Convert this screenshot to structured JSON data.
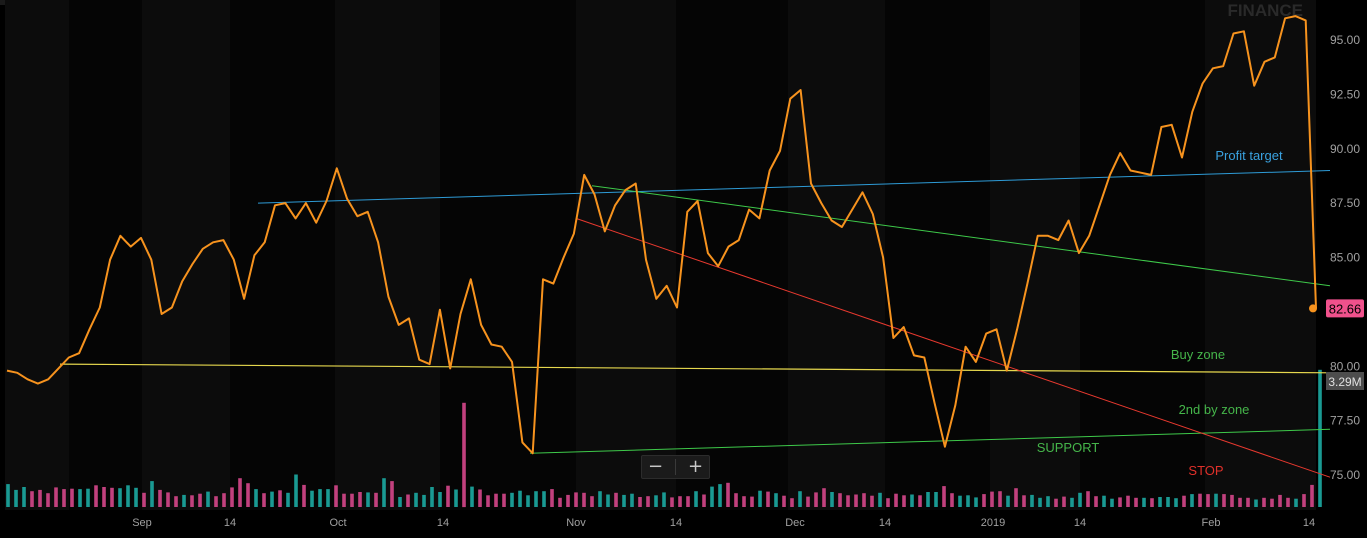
{
  "watermark": "FINANCE",
  "zoom_controls": {
    "minus": "−",
    "plus": "+"
  },
  "colors": {
    "price": "#f7931e",
    "volume_up": "#1a9a93",
    "volume_down": "#c2417e",
    "profit_target": "#2e9bd6",
    "buy_zone": "#e6d84e",
    "green_trend": "#3ec94a",
    "stop": "#e8392f",
    "label_green": "#45b54a",
    "label_blue": "#3aa2e0",
    "label_red": "#e0302a",
    "last_price_badge": "#f0518c",
    "volume_badge": "#4d4d4d"
  },
  "chart_data": {
    "type": "line",
    "x_tick_labels": [
      "Sep",
      "14",
      "Oct",
      "14",
      "Nov",
      "14",
      "Dec",
      "14",
      "2019",
      "14",
      "Feb",
      "14"
    ],
    "y_tick_labels": [
      "95.00",
      "92.50",
      "90.00",
      "87.50",
      "85.00",
      "80.00",
      "77.50",
      "75.00"
    ],
    "ylim": [
      73.5,
      96.8
    ],
    "last_price": "82.66",
    "last_volume": "3.29M",
    "series": [
      {
        "values": [
          79.8,
          79.7,
          79.4,
          79.2,
          79.4,
          79.9,
          80.4,
          80.6,
          81.7,
          82.7,
          84.9,
          86.0,
          85.5,
          85.9,
          84.9,
          82.4,
          82.7,
          83.9,
          84.7,
          85.4,
          85.7,
          85.8,
          84.9,
          83.1,
          85.1,
          85.7,
          87.4,
          87.5,
          86.8,
          87.5,
          86.6,
          87.6,
          89.1,
          87.7,
          86.9,
          87.1,
          85.7,
          83.2,
          81.9,
          82.2,
          80.3,
          80.1,
          82.6,
          79.9,
          82.4,
          84.0,
          81.9,
          81.0,
          80.9,
          80.2,
          76.5,
          76.0,
          84.0,
          83.8,
          85.0,
          86.1,
          88.8,
          87.9,
          86.2,
          87.4,
          88.1,
          88.4,
          84.9,
          83.1,
          83.7,
          82.7,
          87.1,
          87.6,
          85.2,
          84.6,
          85.5,
          85.8,
          87.2,
          86.8,
          89.0,
          89.9,
          92.3,
          92.7,
          88.4,
          87.5,
          86.7,
          86.4,
          87.2,
          88.0,
          87.0,
          85.0,
          81.3,
          81.8,
          80.5,
          80.4,
          78.3,
          76.3,
          78.2,
          80.9,
          80.2,
          81.5,
          81.7,
          79.8,
          81.7,
          83.8,
          86.0,
          86.0,
          85.8,
          86.7,
          85.2,
          86.0,
          87.4,
          88.8,
          89.8,
          89.0,
          88.9,
          88.8,
          91.0,
          91.1,
          89.6,
          91.7,
          93.0,
          93.7,
          93.8,
          95.3,
          95.4,
          92.9,
          94.0,
          94.2,
          96.0,
          96.1,
          95.9,
          82.66
        ]
      }
    ],
    "volume": {
      "values": [
        0.55,
        0.41,
        0.48,
        0.38,
        0.41,
        0.33,
        0.47,
        0.43,
        0.44,
        0.43,
        0.44,
        0.52,
        0.48,
        0.46,
        0.45,
        0.52,
        0.46,
        0.34,
        0.62,
        0.41,
        0.35,
        0.26,
        0.29,
        0.28,
        0.32,
        0.37,
        0.26,
        0.33,
        0.47,
        0.69,
        0.57,
        0.43,
        0.33,
        0.37,
        0.4,
        0.34,
        0.78,
        0.53,
        0.39,
        0.43,
        0.43,
        0.52,
        0.32,
        0.32,
        0.36,
        0.35,
        0.34,
        0.69,
        0.62,
        0.24,
        0.3,
        0.34,
        0.29,
        0.48,
        0.36,
        0.51,
        0.42,
        2.5,
        0.49,
        0.42,
        0.28,
        0.32,
        0.32,
        0.34,
        0.39,
        0.28,
        0.38,
        0.38,
        0.43,
        0.22,
        0.29,
        0.35,
        0.34,
        0.26,
        0.38,
        0.3,
        0.34,
        0.29,
        0.32,
        0.24,
        0.26,
        0.28,
        0.35,
        0.23,
        0.26,
        0.26,
        0.38,
        0.3,
        0.49,
        0.55,
        0.58,
        0.33,
        0.26,
        0.25,
        0.39,
        0.37,
        0.33,
        0.27,
        0.21,
        0.38,
        0.25,
        0.35,
        0.45,
        0.36,
        0.33,
        0.28,
        0.3,
        0.33,
        0.27,
        0.34,
        0.21,
        0.32,
        0.28,
        0.3,
        0.28,
        0.36,
        0.36,
        0.5,
        0.33,
        0.27,
        0.28,
        0.23,
        0.31,
        0.37,
        0.38,
        0.27,
        0.45,
        0.28,
        0.29,
        0.22,
        0.26,
        0.2,
        0.25,
        0.22,
        0.34,
        0.38,
        0.26,
        0.27,
        0.2,
        0.23,
        0.27,
        0.22,
        0.22,
        0.21,
        0.24,
        0.24,
        0.21,
        0.27,
        0.31,
        0.32,
        0.31,
        0.32,
        0.31,
        0.29,
        0.22,
        0.22,
        0.18,
        0.22,
        0.2,
        0.29,
        0.22,
        0.2,
        0.31,
        0.53,
        3.29
      ],
      "up": [
        1,
        1,
        1,
        0,
        0,
        0,
        0,
        0,
        0,
        1,
        1,
        0,
        0,
        0,
        1,
        1,
        1,
        0,
        1,
        0,
        0,
        0,
        1,
        0,
        0,
        1,
        0,
        0,
        0,
        0,
        0,
        1,
        0,
        1,
        0,
        1,
        1,
        0,
        1,
        1,
        1,
        0,
        0,
        0,
        0,
        1,
        0,
        1,
        0,
        1,
        0,
        1,
        1,
        1,
        1,
        0,
        1,
        0,
        1,
        0,
        0,
        0,
        0,
        1,
        1,
        1,
        1,
        1,
        0,
        0,
        0,
        0,
        0,
        0,
        1,
        1,
        0,
        1,
        1,
        0,
        0,
        1,
        1,
        0,
        0,
        0,
        1,
        0,
        1,
        1,
        0,
        0,
        0,
        0,
        1,
        0,
        1,
        0,
        0,
        1,
        0,
        0,
        0,
        1,
        0,
        0,
        0,
        0,
        0,
        1,
        0,
        0,
        0,
        1,
        0,
        1,
        1,
        0,
        0,
        1,
        1,
        1,
        0,
        0,
        0,
        1,
        0,
        0,
        1,
        1,
        1,
        0,
        0,
        1,
        1,
        0,
        0,
        1,
        1,
        0,
        0,
        0,
        1,
        0,
        1,
        1,
        1,
        0,
        1,
        0,
        0,
        1,
        0,
        0,
        0,
        0,
        1,
        0,
        0,
        0,
        0,
        1,
        0,
        0,
        1
      ]
    },
    "annotations": [
      {
        "id": "profit-target",
        "label": "Profit target",
        "y_start": 87.5,
        "y_end": 89.0,
        "color_key": "profit_target"
      },
      {
        "id": "buy-zone",
        "label": "Buy zone",
        "y_start": 80.1,
        "y_end": 79.7,
        "color_key": "buy_zone"
      },
      {
        "id": "second-buy-zone",
        "label": "2nd by zone",
        "y_start": null,
        "y_end": null,
        "color_key": "green_trend"
      },
      {
        "id": "support",
        "label": "SUPPORT",
        "y_start": 76.0,
        "y_end": 77.1,
        "color_key": "green_trend"
      },
      {
        "id": "stop",
        "label": "STOP",
        "y_start": 86.8,
        "y_end": 74.9,
        "color_key": "stop"
      },
      {
        "id": "upper-trend",
        "label": "",
        "y_start": 88.3,
        "y_end": 83.7,
        "color_key": "green_trend"
      }
    ],
    "grid": "vertical alternating shading"
  }
}
